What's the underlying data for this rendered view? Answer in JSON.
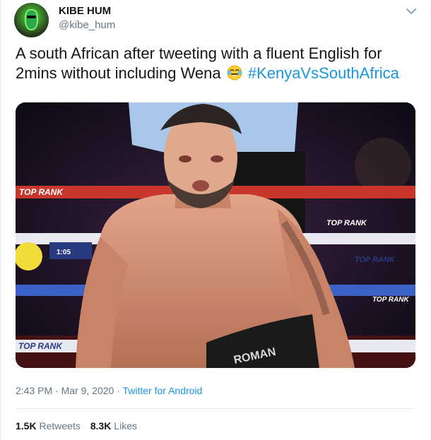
{
  "author": {
    "display_name": "KIBE HUM",
    "handle": "@kibe_hum"
  },
  "tweet": {
    "text_before": "A south African after tweeting with a fluent English for 2mins without including Wena",
    "emoji": "face-with-tears-of-joy",
    "hashtag": "#KenyaVsSouthAfrica"
  },
  "media": {
    "ring_banners": [
      "TOP RANK",
      "TOP RANK",
      "TOP RANK",
      "TOP RANK",
      "TOP RANK"
    ],
    "trunks_text": "ROMAN",
    "clock_text": "1:05"
  },
  "meta": {
    "time": "2:43 PM",
    "separator": "·",
    "date": "Mar 9, 2020",
    "source": "Twitter for Android"
  },
  "stats": {
    "retweets_count": "1.5K",
    "retweets_label": "Retweets",
    "likes_count": "8.3K",
    "likes_label": "Likes"
  },
  "colors": {
    "link": "#1b95e0",
    "secondary_text": "#657786",
    "primary_text": "#14171a",
    "divider": "#e6ecf0"
  }
}
